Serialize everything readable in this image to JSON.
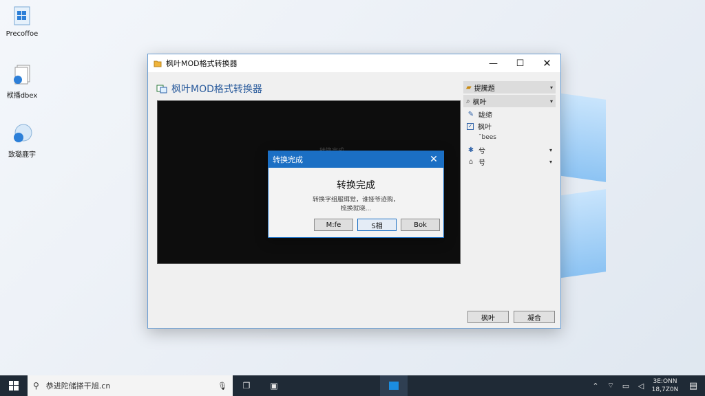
{
  "desktop": {
    "icons": [
      {
        "label": "Precoffoe",
        "icon": "windows-folder-icon"
      },
      {
        "label": "栿播dbex",
        "icon": "document-stack-icon"
      },
      {
        "label": "致璐鹿宇",
        "icon": "globe-user-icon"
      }
    ]
  },
  "window": {
    "title": "枫叶MOD格式转换器",
    "controls": {
      "minimize": "—",
      "maximize": "☐",
      "close": "✕"
    },
    "app_header": "枫叶MOD格式转换器",
    "preview_bg_text": "转换完成",
    "panel": {
      "dropdown1": "提騰題",
      "dropdown2": "枫叶",
      "rows": [
        {
          "icon": "edit-icon",
          "label": "眬缔"
        },
        {
          "icon": "checkbox-icon",
          "label": "枫叶",
          "checked": true
        },
        {
          "icon": "",
          "label": "ˉbees"
        },
        {
          "icon": "tool-icon",
          "label": "兮"
        },
        {
          "icon": "home-icon",
          "label": "号"
        }
      ]
    },
    "buttons": {
      "left": "枫叶",
      "right": "凝合"
    }
  },
  "dialog": {
    "title": "转换完成",
    "heading": "转换完成",
    "message_line1": "转换字组服珥觉，谁娅爷迹购，",
    "message_line2": "梳换就晓...",
    "buttons": [
      "M:fe",
      "S相",
      "Bok"
    ]
  },
  "taskbar": {
    "search_placeholder": "恭进陀储搽干旭.cn",
    "clock_time": "3E:ONN",
    "clock_date": "18,7Z0N"
  },
  "colors": {
    "accent": "#1b6fc4",
    "taskbar": "#1f2a36",
    "preview_bg": "#0d0d0d"
  }
}
